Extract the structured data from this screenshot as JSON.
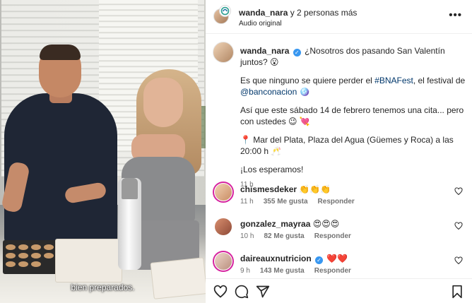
{
  "video": {
    "subtitle": "bien preparados."
  },
  "header": {
    "title_user": "wanda_nara",
    "title_rest": " y 2 personas más",
    "audio": "Audio original",
    "more_icon": "more-horizontal-icon"
  },
  "caption": {
    "username": "wanda_nara",
    "line1": "¿Nosotros dos pasando San Valentín juntos? 😮",
    "para2_a": "Es que ninguno se quiere perder el ",
    "hashtag": "#BNAFest",
    "para2_b": ", el festival de ",
    "mention": "@banconacion",
    "para2_c": " 🪩",
    "para3": "Así que este sábado 14 de febrero tenemos una cita... pero con ustedes 😉 💘",
    "para4": "📍 Mar del Plata, Plaza del Agua (Güemes y Roca) a las 20:00 h 🥂",
    "para5": "¡Los esperamos!",
    "time": "11 h"
  },
  "comments": [
    {
      "username": "chismesdeker",
      "text": "👏👏👏",
      "time": "11 h",
      "likes": "355 Me gusta",
      "reply": "Responder",
      "verified": false,
      "avatar_color": "#e7b48f"
    },
    {
      "username": "gonzalez_mayraa",
      "text": "😍😍😍",
      "time": "10 h",
      "likes": "82 Me gusta",
      "reply": "Responder",
      "verified": false,
      "avatar_color": "#c9795f"
    },
    {
      "username": "daireauxnutricion",
      "text": "❤️❤️",
      "time": "9 h",
      "likes": "143 Me gusta",
      "reply": "Responder",
      "verified": true,
      "avatar_color": "#d8b6a8"
    }
  ],
  "actions": [
    "heart-icon",
    "comment-icon",
    "share-icon",
    "bookmark-icon"
  ],
  "colors": {
    "link": "#00376b",
    "verified": "#3897f0",
    "muted": "#737373",
    "story_ring": "#d6249f"
  }
}
